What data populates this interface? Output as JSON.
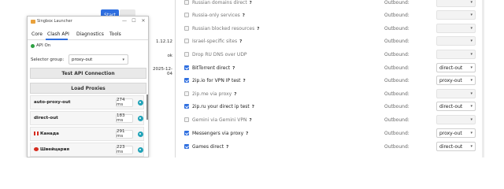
{
  "background": {
    "start_label": "Start",
    "side_values": [
      "1.12.12",
      "ok",
      "2025-12-04"
    ],
    "rules": [
      {
        "label": "Russian domains direct",
        "checked": false,
        "outbound": "",
        "dim": true
      },
      {
        "label": "Russia-only services",
        "checked": false,
        "outbound": "",
        "dim": true
      },
      {
        "label": "Russian blocked resources",
        "checked": false,
        "outbound": "",
        "dim": true
      },
      {
        "label": "Israel-specific sites",
        "checked": false,
        "outbound": "",
        "dim": true
      },
      {
        "label": "Drop RU DNS over UDP",
        "checked": false,
        "outbound": "",
        "dim": true,
        "no_help": true
      },
      {
        "label": "BitTorrent direct",
        "checked": true,
        "outbound": "direct-out",
        "dim": false
      },
      {
        "label": "2ip.io for VPN IP test",
        "checked": true,
        "outbound": "proxy-out",
        "dim": false
      },
      {
        "label": "2ip.me via proxy",
        "checked": false,
        "outbound": "",
        "dim": true
      },
      {
        "label": "2ip.ru your direct ip test",
        "checked": true,
        "outbound": "direct-out",
        "dim": false
      },
      {
        "label": "Gemini via Gemini VPN",
        "checked": false,
        "outbound": "",
        "dim": true
      },
      {
        "label": "Messengers via proxy",
        "checked": true,
        "outbound": "proxy-out",
        "dim": false
      },
      {
        "label": "Games direct",
        "checked": true,
        "outbound": "direct-out",
        "dim": false
      }
    ],
    "outbound_label": "Outbound:",
    "help_glyph": "?"
  },
  "window": {
    "title": "Singbox Launcher",
    "controls": {
      "minimize": "—",
      "maximize": "☐",
      "close": "✕"
    },
    "tabs": [
      "Core",
      "Clash API",
      "Diagnostics",
      "Tools"
    ],
    "active_tab": "Clash API",
    "status": "API On",
    "selector_group_label": "Selector group:",
    "selector_group_value": "proxy-out",
    "test_button": "Test API Connection",
    "load_button": "Load Proxies",
    "proxies": [
      {
        "name": "auto-proxy-out",
        "delay": "274 ms",
        "flag": ""
      },
      {
        "name": "direct-out",
        "delay": "183 ms",
        "flag": ""
      },
      {
        "name": "Канада",
        "delay": "291 ms",
        "flag": "ca"
      },
      {
        "name": "Швейцария",
        "delay": "223 ms",
        "flag": "ch"
      }
    ]
  }
}
